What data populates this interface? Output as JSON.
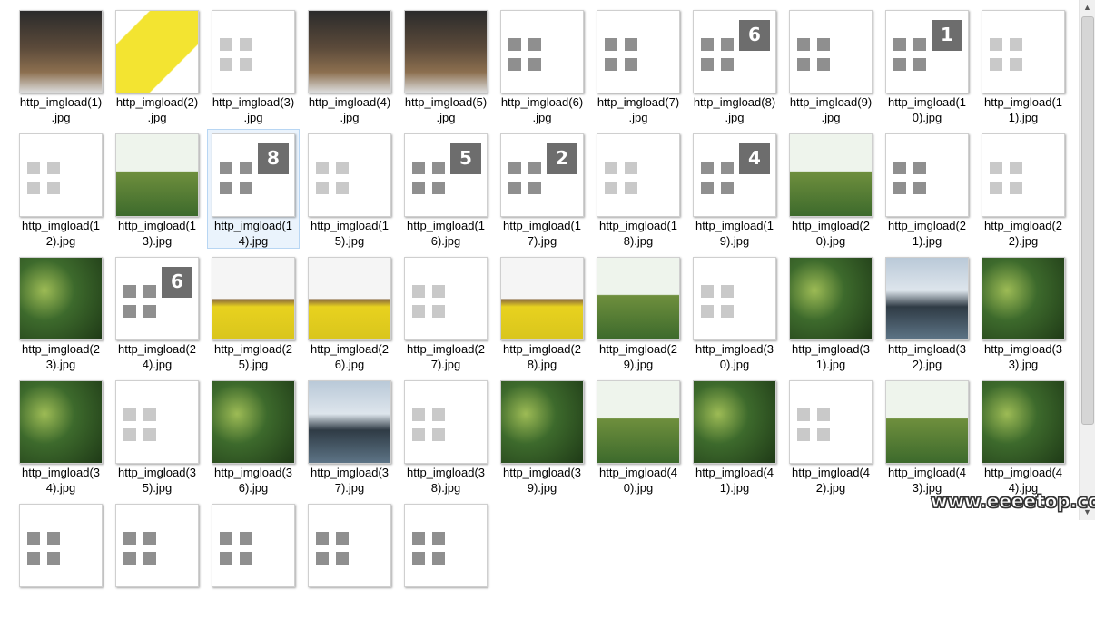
{
  "files": [
    {
      "l1": "http_imgload(1)",
      "l2": ".jpg",
      "thumb": "dark"
    },
    {
      "l1": "http_imgload(2)",
      "l2": ".jpg",
      "thumb": "yellow"
    },
    {
      "l1": "http_imgload(3)",
      "l2": ".jpg",
      "thumb": "sketch"
    },
    {
      "l1": "http_imgload(4)",
      "l2": ".jpg",
      "thumb": "dark"
    },
    {
      "l1": "http_imgload(5)",
      "l2": ".jpg",
      "thumb": "dark"
    },
    {
      "l1": "http_imgload(6)",
      "l2": ".jpg",
      "thumb": "doc"
    },
    {
      "l1": "http_imgload(7)",
      "l2": ".jpg",
      "thumb": "doc"
    },
    {
      "l1": "http_imgload(8)",
      "l2": ".jpg",
      "thumb": "doc",
      "n": "6"
    },
    {
      "l1": "http_imgload(9)",
      "l2": ".jpg",
      "thumb": "doc"
    },
    {
      "l1": "http_imgload(1",
      "l2": "0).jpg",
      "thumb": "doc",
      "n": "1"
    },
    {
      "l1": "http_imgload(1",
      "l2": "1).jpg",
      "thumb": "sketch"
    },
    {
      "l1": "http_imgload(1",
      "l2": "2).jpg",
      "thumb": "sketch"
    },
    {
      "l1": "http_imgload(1",
      "l2": "3).jpg",
      "thumb": "green"
    },
    {
      "l1": "http_imgload(1",
      "l2": "4).jpg",
      "thumb": "doc",
      "n": "8",
      "sel": true
    },
    {
      "l1": "http_imgload(1",
      "l2": "5).jpg",
      "thumb": "sketch"
    },
    {
      "l1": "http_imgload(1",
      "l2": "6).jpg",
      "thumb": "doc",
      "n": "5"
    },
    {
      "l1": "http_imgload(1",
      "l2": "7).jpg",
      "thumb": "doc",
      "n": "2"
    },
    {
      "l1": "http_imgload(1",
      "l2": "8).jpg",
      "thumb": "sketch"
    },
    {
      "l1": "http_imgload(1",
      "l2": "9).jpg",
      "thumb": "doc",
      "n": "4"
    },
    {
      "l1": "http_imgload(2",
      "l2": "0).jpg",
      "thumb": "green"
    },
    {
      "l1": "http_imgload(2",
      "l2": "1).jpg",
      "thumb": "doc"
    },
    {
      "l1": "http_imgload(2",
      "l2": "2).jpg",
      "thumb": "sketch"
    },
    {
      "l1": "http_imgload(2",
      "l2": "3).jpg",
      "thumb": "plants"
    },
    {
      "l1": "http_imgload(2",
      "l2": "4).jpg",
      "thumb": "doc",
      "n": "6"
    },
    {
      "l1": "http_imgload(2",
      "l2": "5).jpg",
      "thumb": "field"
    },
    {
      "l1": "http_imgload(2",
      "l2": "6).jpg",
      "thumb": "field"
    },
    {
      "l1": "http_imgload(2",
      "l2": "7).jpg",
      "thumb": "sketch"
    },
    {
      "l1": "http_imgload(2",
      "l2": "8).jpg",
      "thumb": "field"
    },
    {
      "l1": "http_imgload(2",
      "l2": "9).jpg",
      "thumb": "green"
    },
    {
      "l1": "http_imgload(3",
      "l2": "0).jpg",
      "thumb": "sketch"
    },
    {
      "l1": "http_imgload(3",
      "l2": "1).jpg",
      "thumb": "plants"
    },
    {
      "l1": "http_imgload(3",
      "l2": "2).jpg",
      "thumb": "blue"
    },
    {
      "l1": "http_imgload(3",
      "l2": "3).jpg",
      "thumb": "plants"
    },
    {
      "l1": "http_imgload(3",
      "l2": "4).jpg",
      "thumb": "plants"
    },
    {
      "l1": "http_imgload(3",
      "l2": "5).jpg",
      "thumb": "sketch"
    },
    {
      "l1": "http_imgload(3",
      "l2": "6).jpg",
      "thumb": "plants"
    },
    {
      "l1": "http_imgload(3",
      "l2": "7).jpg",
      "thumb": "blue"
    },
    {
      "l1": "http_imgload(3",
      "l2": "8).jpg",
      "thumb": "sketch"
    },
    {
      "l1": "http_imgload(3",
      "l2": "9).jpg",
      "thumb": "plants"
    },
    {
      "l1": "http_imgload(4",
      "l2": "0).jpg",
      "thumb": "green"
    },
    {
      "l1": "http_imgload(4",
      "l2": "1).jpg",
      "thumb": "plants"
    },
    {
      "l1": "http_imgload(4",
      "l2": "2).jpg",
      "thumb": "sketch"
    },
    {
      "l1": "http_imgload(4",
      "l2": "3).jpg",
      "thumb": "green"
    },
    {
      "l1": "http_imgload(4",
      "l2": "4).jpg",
      "thumb": "plants"
    },
    {
      "l1": "",
      "l2": "",
      "thumb": "doc"
    },
    {
      "l1": "",
      "l2": "",
      "thumb": "doc"
    },
    {
      "l1": "",
      "l2": "",
      "thumb": "doc"
    },
    {
      "l1": "",
      "l2": "",
      "thumb": "doc"
    },
    {
      "l1": "",
      "l2": "",
      "thumb": "doc"
    }
  ],
  "watermark": "www.eeeetop.com",
  "scroll": {
    "up_icon": "▲",
    "down_icon": "▼"
  }
}
